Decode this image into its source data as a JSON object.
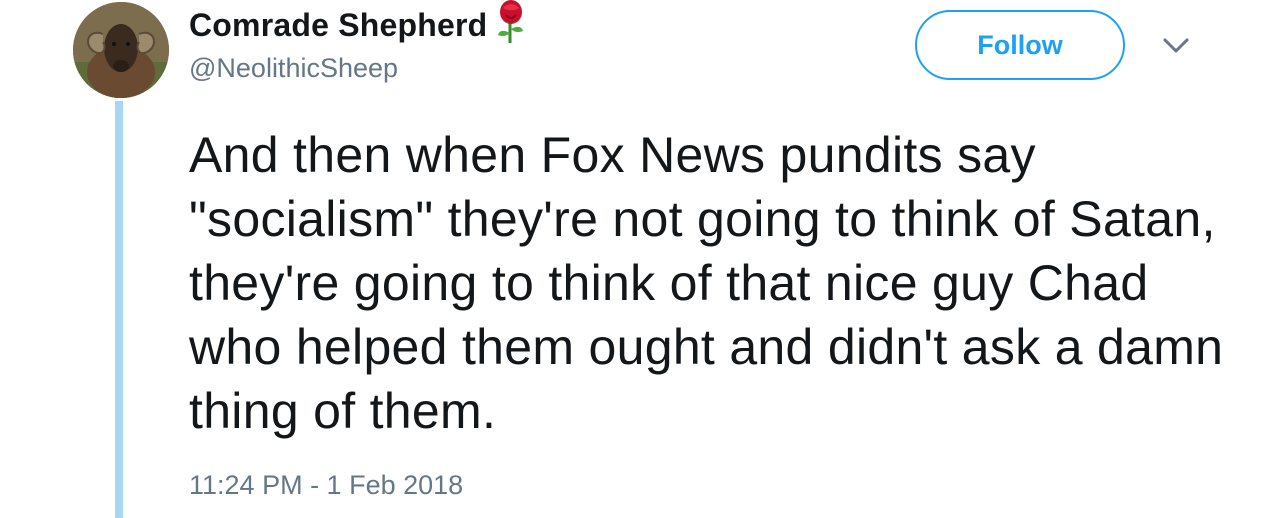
{
  "author": {
    "display_name": "Comrade Shepherd",
    "name_emoji": "rose-icon",
    "handle": "@NeolithicSheep",
    "avatar": "sheep-avatar"
  },
  "actions": {
    "follow_label": "Follow",
    "menu_icon": "chevron-down-icon"
  },
  "tweet": {
    "text": "And then when Fox News pundits say \"socialism\" they're not going to think of Satan, they're going to think of that nice guy Chad who helped them ought and didn't ask a damn thing of them.",
    "timestamp": "11:24 PM - 1 Feb 2018"
  },
  "colors": {
    "accent": "#1da1f2",
    "thread_line": "#a6d8f5",
    "secondary_text": "#657786",
    "primary_text": "#14171a"
  }
}
